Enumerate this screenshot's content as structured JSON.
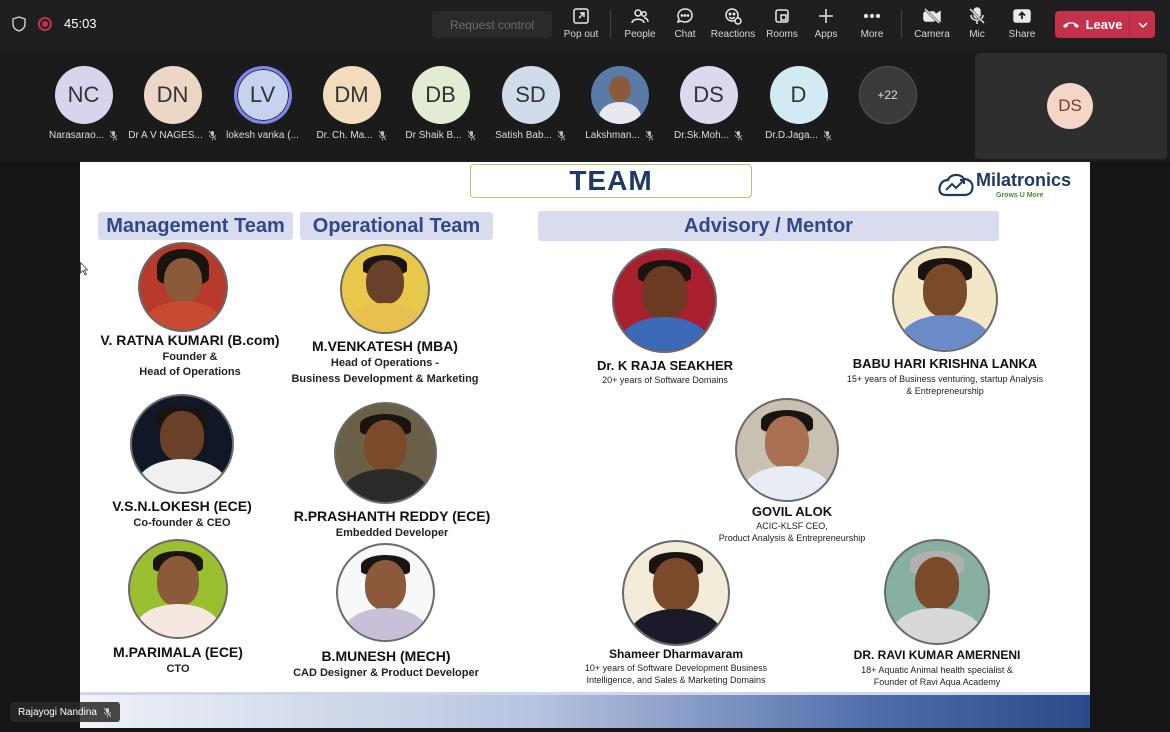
{
  "toolbar": {
    "timer": "45:03",
    "request_control": "Request control",
    "buttons": [
      {
        "label": "Pop out",
        "icon": "popout-icon"
      },
      {
        "label": "People",
        "icon": "people-icon"
      },
      {
        "label": "Chat",
        "icon": "chat-icon"
      },
      {
        "label": "Reactions",
        "icon": "reactions-icon"
      },
      {
        "label": "Rooms",
        "icon": "rooms-icon"
      },
      {
        "label": "Apps",
        "icon": "apps-icon"
      },
      {
        "label": "More",
        "icon": "more-icon"
      },
      {
        "label": "Camera",
        "icon": "camera-off-icon"
      },
      {
        "label": "Mic",
        "icon": "mic-off-icon"
      },
      {
        "label": "Share",
        "icon": "share-icon"
      }
    ],
    "leave": "Leave",
    "leave_color": "#c4314b"
  },
  "participants": [
    {
      "initials": "NC",
      "name": "Narasarao...",
      "color": "#d8d4ee"
    },
    {
      "initials": "DN",
      "name": "Dr A V NAGES...",
      "color": "#ecd6c6"
    },
    {
      "initials": "LV",
      "name": "lokesh vanka (...",
      "color": "#c6d2ee"
    },
    {
      "initials": "DM",
      "name": "Dr. Ch. Ma...",
      "color": "#f3dcbc"
    },
    {
      "initials": "DB",
      "name": "Dr Shaik B...",
      "color": "#e2ecd2"
    },
    {
      "initials": "SD",
      "name": "Satish Bab...",
      "color": "#d0dcea"
    },
    {
      "initials": "",
      "name": "Lakshman...",
      "color": "#5a7aa8"
    },
    {
      "initials": "DS",
      "name": "Dr.Sk.Moh...",
      "color": "#dcd8ee"
    },
    {
      "initials": "D",
      "name": "Dr.D.Jaga...",
      "color": "#d2eaf2"
    }
  ],
  "overflow_count": "+22",
  "self": {
    "initials": "DS"
  },
  "slide": {
    "title": "TEAM",
    "logo_text": "Milatronics",
    "logo_tagline": "Grows U More",
    "headers": {
      "management": "Management Team",
      "operational": "Operational Team",
      "advisory": "Advisory / Mentor"
    },
    "members": [
      {
        "name": "V. RATNA KUMARI (B.com)",
        "role_line1": "Founder &",
        "role_line2": "Head of Operations"
      },
      {
        "name": "M.VENKATESH (MBA)",
        "role_line1": "Head of Operations -",
        "role_line2": "Business Development & Marketing"
      },
      {
        "name": "Dr. K RAJA SEAKHER",
        "role_line1": "20+ years of Software  Domains"
      },
      {
        "name": "BABU HARI KRISHNA LANKA",
        "role_line1": "15+ years of Business venturing, startup Analysis",
        "role_line2": "& Entrepreneurship"
      },
      {
        "name": "V.S.N.LOKESH (ECE)",
        "role_line1": "Co-founder & CEO"
      },
      {
        "name": "R.PRASHANTH REDDY (ECE)",
        "role_line1": "Embedded Developer"
      },
      {
        "name": "GOVIL ALOK",
        "role_line1": "ACIC-KLSF CEO,",
        "role_line2": "Product Analysis & Entrepreneurship"
      },
      {
        "name": "M.PARIMALA (ECE)",
        "role_line1": "CTO"
      },
      {
        "name": "B.MUNESH (MECH)",
        "role_line1": "CAD Designer & Product Developer"
      },
      {
        "name": "Shameer Dharmavaram",
        "role_line1": "10+ years of Software Development Business",
        "role_line2": "Intelligence, and Sales & Marketing Domains"
      },
      {
        "name": "DR. RAVI KUMAR AMERNENI",
        "role_line1": "18+ Aquatic Animal health specialist &",
        "role_line2": "Founder of Ravi Aqua Academy"
      }
    ]
  },
  "caption": {
    "name": "Rajayogi Nandina"
  }
}
